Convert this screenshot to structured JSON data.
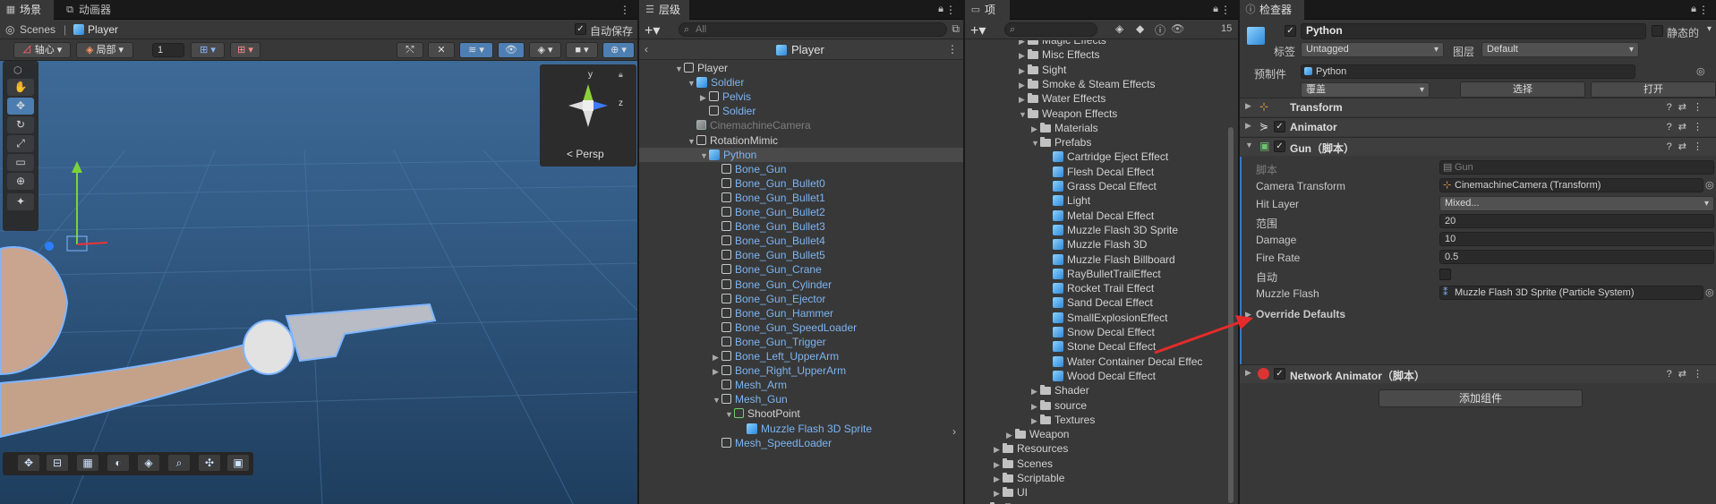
{
  "scene_window": {
    "tab_scene": "场景",
    "tab_animator": "动画器",
    "breadcrumb_root": "Scenes",
    "breadcrumb_current": "Player",
    "autosave_label": "自动保存",
    "pivot_label": "轴心",
    "local_label": "局部",
    "grid_value": "1",
    "gizmo_persp": "Persp",
    "gizmo_y": "y",
    "gizmo_z": "z"
  },
  "hierarchy": {
    "tab": "层级",
    "search_placeholder": "All",
    "prefab_title": "Player",
    "items": [
      {
        "label": "Player",
        "indent": 0,
        "expand": "▼",
        "icon": "outline",
        "style": ""
      },
      {
        "label": "Soldier",
        "indent": 1,
        "expand": "▼",
        "icon": "prefab",
        "style": "blue"
      },
      {
        "label": "Pelvis",
        "indent": 2,
        "expand": "▶",
        "icon": "outline",
        "style": "blue"
      },
      {
        "label": "Soldier",
        "indent": 2,
        "expand": "",
        "icon": "outline",
        "style": "blue"
      },
      {
        "label": "CinemachineCamera",
        "indent": 1,
        "expand": "",
        "icon": "gray",
        "style": "dim"
      },
      {
        "label": "RotationMimic",
        "indent": 1,
        "expand": "▼",
        "icon": "outline",
        "style": ""
      },
      {
        "label": "Python",
        "indent": 2,
        "expand": "▼",
        "icon": "prefab",
        "style": "blue",
        "selected": true
      },
      {
        "label": "Bone_Gun",
        "indent": 3,
        "expand": "",
        "icon": "outline",
        "style": "blue"
      },
      {
        "label": "Bone_Gun_Bullet0",
        "indent": 3,
        "expand": "",
        "icon": "outline",
        "style": "blue"
      },
      {
        "label": "Bone_Gun_Bullet1",
        "indent": 3,
        "expand": "",
        "icon": "outline",
        "style": "blue"
      },
      {
        "label": "Bone_Gun_Bullet2",
        "indent": 3,
        "expand": "",
        "icon": "outline",
        "style": "blue"
      },
      {
        "label": "Bone_Gun_Bullet3",
        "indent": 3,
        "expand": "",
        "icon": "outline",
        "style": "blue"
      },
      {
        "label": "Bone_Gun_Bullet4",
        "indent": 3,
        "expand": "",
        "icon": "outline",
        "style": "blue"
      },
      {
        "label": "Bone_Gun_Bullet5",
        "indent": 3,
        "expand": "",
        "icon": "outline",
        "style": "blue"
      },
      {
        "label": "Bone_Gun_Crane",
        "indent": 3,
        "expand": "",
        "icon": "outline",
        "style": "blue"
      },
      {
        "label": "Bone_Gun_Cylinder",
        "indent": 3,
        "expand": "",
        "icon": "outline",
        "style": "blue"
      },
      {
        "label": "Bone_Gun_Ejector",
        "indent": 3,
        "expand": "",
        "icon": "outline",
        "style": "blue"
      },
      {
        "label": "Bone_Gun_Hammer",
        "indent": 3,
        "expand": "",
        "icon": "outline",
        "style": "blue"
      },
      {
        "label": "Bone_Gun_SpeedLoader",
        "indent": 3,
        "expand": "",
        "icon": "outline",
        "style": "blue"
      },
      {
        "label": "Bone_Gun_Trigger",
        "indent": 3,
        "expand": "",
        "icon": "outline",
        "style": "blue"
      },
      {
        "label": "Bone_Left_UpperArm",
        "indent": 3,
        "expand": "▶",
        "icon": "outline",
        "style": "blue"
      },
      {
        "label": "Bone_Right_UpperArm",
        "indent": 3,
        "expand": "▶",
        "icon": "outline",
        "style": "blue"
      },
      {
        "label": "Mesh_Arm",
        "indent": 3,
        "expand": "",
        "icon": "outline",
        "style": "blue"
      },
      {
        "label": "Mesh_Gun",
        "indent": 3,
        "expand": "▼",
        "icon": "outline",
        "style": "blue"
      },
      {
        "label": "ShootPoint",
        "indent": 4,
        "expand": "▼",
        "icon": "green",
        "style": ""
      },
      {
        "label": "Muzzle Flash 3D Sprite",
        "indent": 5,
        "expand": "",
        "icon": "prefab",
        "style": "blue"
      },
      {
        "label": "Mesh_SpeedLoader",
        "indent": 3,
        "expand": "",
        "icon": "outline",
        "style": "blue"
      }
    ]
  },
  "project": {
    "tab": "项目",
    "hidden_count": "15",
    "items": [
      {
        "label": "Magic Effects",
        "indent": 3,
        "expand": "▶",
        "icon": "folder"
      },
      {
        "label": "Misc Effects",
        "indent": 3,
        "expand": "▶",
        "icon": "folder"
      },
      {
        "label": "Sight",
        "indent": 3,
        "expand": "▶",
        "icon": "folder"
      },
      {
        "label": "Smoke & Steam Effects",
        "indent": 3,
        "expand": "▶",
        "icon": "folder"
      },
      {
        "label": "Water Effects",
        "indent": 3,
        "expand": "▶",
        "icon": "folder"
      },
      {
        "label": "Weapon Effects",
        "indent": 3,
        "expand": "▼",
        "icon": "folder"
      },
      {
        "label": "Materials",
        "indent": 4,
        "expand": "▶",
        "icon": "folder"
      },
      {
        "label": "Prefabs",
        "indent": 4,
        "expand": "▼",
        "icon": "folder"
      },
      {
        "label": "Cartridge Eject Effect",
        "indent": 5,
        "expand": "",
        "icon": "prefab"
      },
      {
        "label": "Flesh Decal Effect",
        "indent": 5,
        "expand": "",
        "icon": "prefab"
      },
      {
        "label": "Grass Decal Effect",
        "indent": 5,
        "expand": "",
        "icon": "prefab"
      },
      {
        "label": "Light",
        "indent": 5,
        "expand": "",
        "icon": "prefab"
      },
      {
        "label": "Metal Decal Effect",
        "indent": 5,
        "expand": "",
        "icon": "prefab"
      },
      {
        "label": "Muzzle Flash 3D Sprite",
        "indent": 5,
        "expand": "",
        "icon": "prefab"
      },
      {
        "label": "Muzzle Flash 3D",
        "indent": 5,
        "expand": "",
        "icon": "prefab"
      },
      {
        "label": "Muzzle Flash Billboard",
        "indent": 5,
        "expand": "",
        "icon": "prefab"
      },
      {
        "label": "RayBulletTrailEffect",
        "indent": 5,
        "expand": "",
        "icon": "prefab"
      },
      {
        "label": "Rocket Trail Effect",
        "indent": 5,
        "expand": "",
        "icon": "prefab"
      },
      {
        "label": "Sand Decal Effect",
        "indent": 5,
        "expand": "",
        "icon": "prefab"
      },
      {
        "label": "SmallExplosionEffect",
        "indent": 5,
        "expand": "",
        "icon": "prefab"
      },
      {
        "label": "Snow Decal Effect",
        "indent": 5,
        "expand": "",
        "icon": "prefab"
      },
      {
        "label": "Stone Decal Effect",
        "indent": 5,
        "expand": "",
        "icon": "prefab"
      },
      {
        "label": "Water Container Decal Effec",
        "indent": 5,
        "expand": "",
        "icon": "prefab"
      },
      {
        "label": "Wood Decal Effect",
        "indent": 5,
        "expand": "",
        "icon": "prefab"
      },
      {
        "label": "Shader",
        "indent": 4,
        "expand": "▶",
        "icon": "folder"
      },
      {
        "label": "source",
        "indent": 4,
        "expand": "▶",
        "icon": "folder"
      },
      {
        "label": "Textures",
        "indent": 4,
        "expand": "▶",
        "icon": "folder"
      },
      {
        "label": "Weapon",
        "indent": 2,
        "expand": "▶",
        "icon": "folder"
      },
      {
        "label": "Resources",
        "indent": 1,
        "expand": "▶",
        "icon": "folder"
      },
      {
        "label": "Scenes",
        "indent": 1,
        "expand": "▶",
        "icon": "folder"
      },
      {
        "label": "Scriptable",
        "indent": 1,
        "expand": "▶",
        "icon": "folder"
      },
      {
        "label": "UI",
        "indent": 1,
        "expand": "▶",
        "icon": "folder"
      },
      {
        "label": "Fonts",
        "indent": 0,
        "expand": "▼",
        "icon": "folder"
      }
    ]
  },
  "inspector": {
    "tab": "检查器",
    "object_name": "Python",
    "static_label": "静态的",
    "tag_label": "标签",
    "tag_value": "Untagged",
    "layer_label": "图层",
    "layer_value": "Default",
    "prefab_label": "预制件",
    "prefab_value": "Python",
    "overrides_value": "覆盖",
    "select_button": "选择",
    "open_button": "打开",
    "transform": "Transform",
    "animator": "Animator",
    "gun": "Gun（脚本）",
    "script_label": "脚本",
    "script_value": "Gun",
    "camera_label": "Camera Transform",
    "camera_value": "CinemachineCamera (Transform)",
    "hitlayer_label": "Hit Layer",
    "hitlayer_value": "Mixed...",
    "range_label": "范围",
    "range_value": "20",
    "damage_label": "Damage",
    "damage_value": "10",
    "firerate_label": "Fire Rate",
    "firerate_value": "0.5",
    "auto_label": "自动",
    "muzzle_label": "Muzzle Flash",
    "muzzle_value": "Muzzle Flash 3D Sprite (Particle System)",
    "override_defaults": "Override Defaults",
    "network_animator": "Network Animator（脚本）",
    "add_component": "添加组件"
  }
}
